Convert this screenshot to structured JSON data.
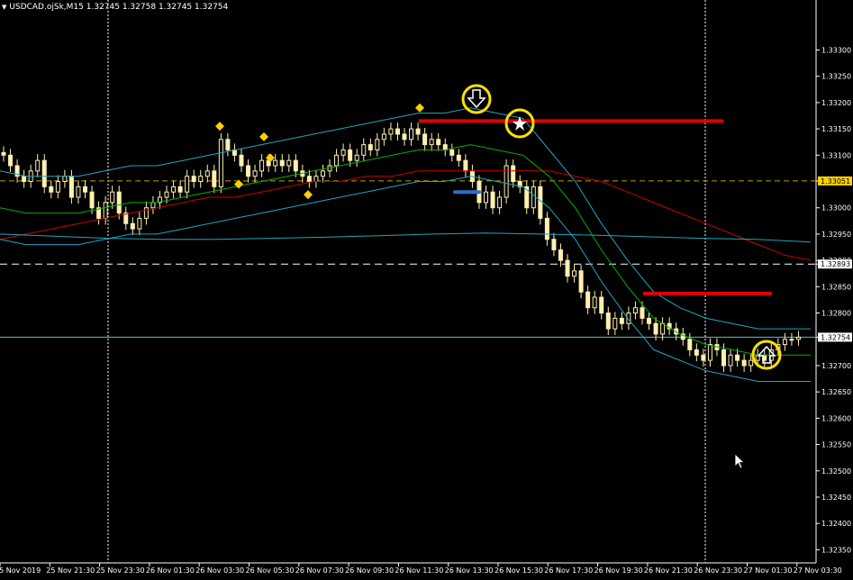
{
  "header": {
    "menu_icon": "triangle-down-icon",
    "symbol": "USDCAD.ojSk,M15",
    "open": "1.32745",
    "high": "1.32758",
    "low": "1.32745",
    "close": "1.32754"
  },
  "colors": {
    "background": "#000000",
    "bull_candle": "#fff0b0",
    "bear_candle": "#fff0b0",
    "ma_fast": "#00b000",
    "ma_slow": "#cc0000",
    "bollinger": "#1fa5c0",
    "ma_long": "#1fa5c0",
    "marker": "#ffd000",
    "annotation_line": "#e00000",
    "blue_bar": "#2a6fd0",
    "circle": "#ffe000",
    "price_tag_bg": "#ffd000",
    "grid_dash": "#ffffff",
    "horizontal_level": "#c89b00"
  },
  "chart_data": {
    "type": "candlestick",
    "title": "",
    "ylim": [
      1.32325,
      1.33395
    ],
    "y_ticks": [
      "1.33300",
      "1.33250",
      "1.33200",
      "1.33150",
      "1.33100",
      "1.33051",
      "1.33000",
      "1.32950",
      "1.32900",
      "1.32893",
      "1.32850",
      "1.32800",
      "1.32754",
      "1.32700",
      "1.32650",
      "1.32600",
      "1.32550",
      "1.32500",
      "1.32450",
      "1.32400",
      "1.32350"
    ],
    "x_ticks": [
      "25 Nov 2019",
      "25 Nov 21:30",
      "25 Nov 23:30",
      "26 Nov 01:30",
      "26 Nov 03:30",
      "26 Nov 05:30",
      "26 Nov 07:30",
      "26 Nov 09:30",
      "26 Nov 11:30",
      "26 Nov 13:30",
      "26 Nov 15:30",
      "26 Nov 17:30",
      "26 Nov 19:30",
      "26 Nov 21:30",
      "26 Nov 23:30",
      "27 Nov 01:30",
      "27 Nov 03:30"
    ],
    "current_price": "1.32754",
    "level_price": "1.33051",
    "dashed_level_price": "1.32893",
    "closes": [
      1.331,
      1.3308,
      1.3306,
      1.3305,
      1.3307,
      1.3309,
      1.3304,
      1.3303,
      1.3305,
      1.3306,
      1.3302,
      1.3304,
      1.3303,
      1.33,
      1.3298,
      1.3301,
      1.3303,
      1.3299,
      1.3297,
      1.3296,
      1.3298,
      1.33,
      1.3301,
      1.3302,
      1.3303,
      1.3304,
      1.3303,
      1.3306,
      1.3305,
      1.3306,
      1.3307,
      1.3304,
      1.3313,
      1.3311,
      1.331,
      1.3308,
      1.3306,
      1.3307,
      1.3309,
      1.3308,
      1.3309,
      1.3308,
      1.3309,
      1.3307,
      1.3306,
      1.3305,
      1.3306,
      1.3307,
      1.3308,
      1.331,
      1.3311,
      1.3309,
      1.331,
      1.3312,
      1.3311,
      1.3313,
      1.3314,
      1.3315,
      1.3314,
      1.3313,
      1.3315,
      1.3314,
      1.3312,
      1.3313,
      1.3312,
      1.3311,
      1.331,
      1.3309,
      1.3307,
      1.3305,
      1.3301,
      1.3303,
      1.33,
      1.3302,
      1.3308,
      1.3305,
      1.3304,
      1.33,
      1.3304,
      1.3298,
      1.3294,
      1.3292,
      1.329,
      1.3287,
      1.3288,
      1.3284,
      1.3281,
      1.3283,
      1.328,
      1.3277,
      1.3279,
      1.3278,
      1.328,
      1.3281,
      1.3279,
      1.3278,
      1.3276,
      1.3278,
      1.3277,
      1.3276,
      1.3275,
      1.3273,
      1.3272,
      1.3271,
      1.3274,
      1.3273,
      1.327,
      1.3272,
      1.3271,
      1.327,
      1.3271,
      1.3272,
      1.3271,
      1.3273,
      1.3274,
      1.3275,
      1.3275,
      1.32754
    ],
    "ma_fast": [
      1.33,
      1.3299,
      1.3299,
      1.3299,
      1.33,
      1.3301,
      1.3301,
      1.3302,
      1.3303,
      1.3304,
      1.3305,
      1.3306,
      1.3307,
      1.3308,
      1.3309,
      1.331,
      1.3311,
      1.3311,
      1.3312,
      1.3311,
      1.331,
      1.3306,
      1.33,
      1.3292,
      1.3285,
      1.3279,
      1.3276,
      1.3274,
      1.3273,
      1.3272,
      1.3272,
      1.3272
    ],
    "ma_slow": [
      1.3294,
      1.3295,
      1.3296,
      1.3297,
      1.3298,
      1.3299,
      1.33,
      1.3301,
      1.3302,
      1.3302,
      1.3303,
      1.3304,
      1.3305,
      1.3305,
      1.3306,
      1.3306,
      1.3307,
      1.3307,
      1.3307,
      1.3307,
      1.3307,
      1.3307,
      1.3306,
      1.3305,
      1.3303,
      1.3301,
      1.3299,
      1.3297,
      1.3295,
      1.3293,
      1.3291,
      1.329
    ],
    "annotations": {
      "down_arrows": 1,
      "up_arrows": 1,
      "stars": 1,
      "diamonds": 7
    }
  }
}
